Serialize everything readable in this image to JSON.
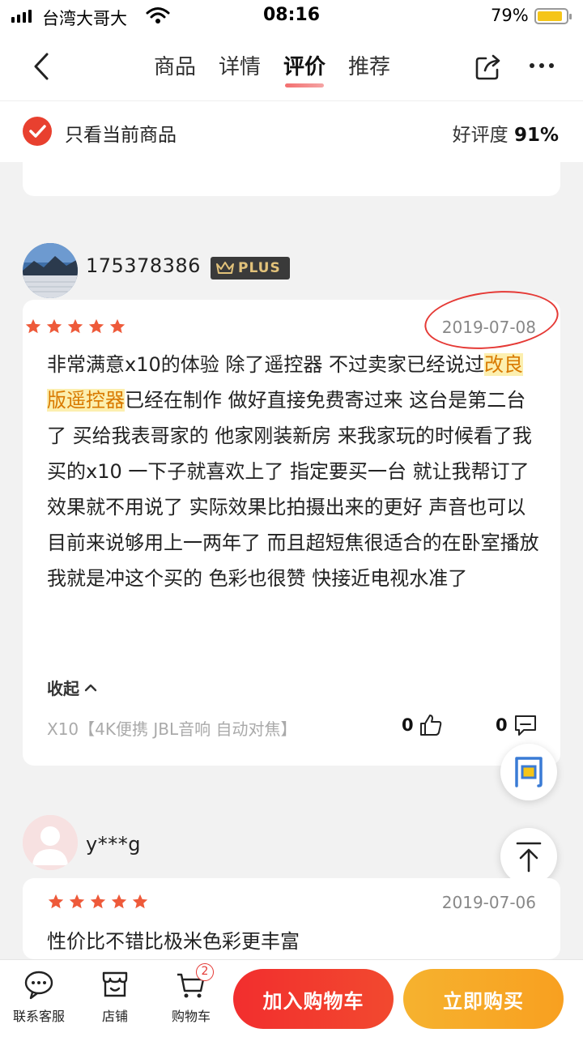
{
  "status_bar": {
    "carrier": "台湾大哥大",
    "time": "08:16",
    "battery": "79%"
  },
  "nav": {
    "tabs": [
      "商品",
      "详情",
      "评价",
      "推荐"
    ],
    "active_tab": "评价"
  },
  "filter": {
    "label": "只看当前商品",
    "praise_label": "好评度",
    "praise_value": "91%"
  },
  "reviews": [
    {
      "username": "175378386",
      "badge": "PLUS",
      "stars": 5,
      "date": "2019-07-08",
      "content_pre": "非常满意x10的体验 除了遥控器 不过卖家已经说过",
      "content_highlight": "改良版遥控器",
      "content_post": "已经在制作 做好直接免费寄过来 这台是第二台了 买给我表哥家的 他家刚装新房 来我家玩的时候看了我买的x10 一下子就喜欢上了 指定要买一台 就让我帮订了",
      "content_2": "效果就不用说了 实际效果比拍摄出来的更好 声音也可以 目前来说够用上一两年了 而且超短焦很适合的在卧室播放 我就是冲这个买的 色彩也很赞 快接近电视水准了",
      "collapse_label": "收起",
      "spec": "X10【4K便携 JBL音响 自动对焦】",
      "likes": "0",
      "comments": "0"
    },
    {
      "username": "y***g",
      "stars": 5,
      "date": "2019-07-06",
      "content": "性价比不错比极米色彩更丰富"
    }
  ],
  "floating": {
    "ask_icon": "问"
  },
  "bottom_bar": {
    "service": "联系客服",
    "shop": "店铺",
    "cart": "购物车",
    "cart_count": "2",
    "add_to_cart": "加入购物车",
    "buy_now": "立即购买"
  },
  "colors": {
    "accent_red": "#e8402f",
    "buy_orange": "#f8a020"
  }
}
